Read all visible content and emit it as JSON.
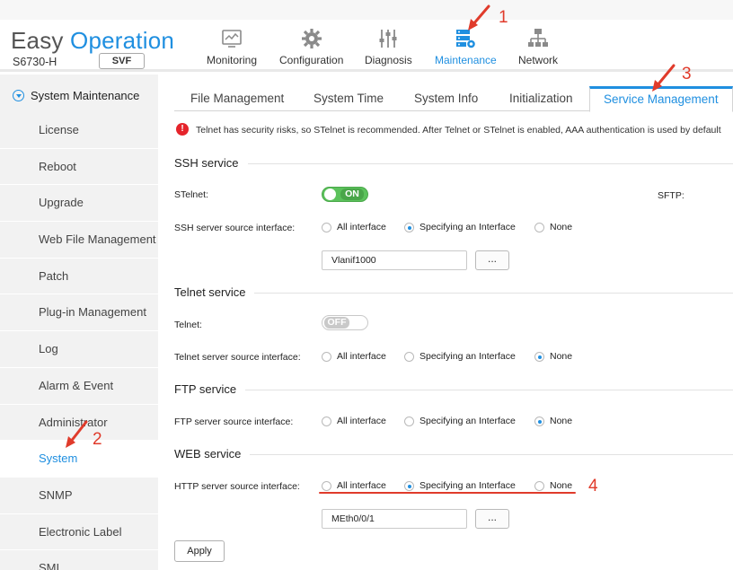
{
  "header": {
    "brand_part1": "Easy",
    "brand_part2": "Operation",
    "device_model": "S6730-H",
    "svf_label": "SVF",
    "nav": [
      {
        "label": "Monitoring",
        "icon": "monitor-icon"
      },
      {
        "label": "Configuration",
        "icon": "gear-icon"
      },
      {
        "label": "Diagnosis",
        "icon": "sliders-icon"
      },
      {
        "label": "Maintenance",
        "icon": "maintenance-icon",
        "active": true
      },
      {
        "label": "Network",
        "icon": "network-icon"
      }
    ],
    "accent_color": "#1f8fe0"
  },
  "sidebar": {
    "title": "System Maintenance",
    "items": [
      {
        "label": "License"
      },
      {
        "label": "Reboot"
      },
      {
        "label": "Upgrade"
      },
      {
        "label": "Web File Management"
      },
      {
        "label": "Patch"
      },
      {
        "label": "Plug-in Management"
      },
      {
        "label": "Log"
      },
      {
        "label": "Alarm & Event"
      },
      {
        "label": "Administrator"
      },
      {
        "label": "System",
        "active": true
      },
      {
        "label": "SNMP"
      },
      {
        "label": "Electronic Label"
      },
      {
        "label": "SMI"
      }
    ]
  },
  "tabs": [
    {
      "label": "File Management"
    },
    {
      "label": "System Time"
    },
    {
      "label": "System Info"
    },
    {
      "label": "Initialization"
    },
    {
      "label": "Service Management",
      "active": true
    }
  ],
  "warning": {
    "text": "Telnet has security risks, so STelnet is recommended. After Telnet or STelnet is enabled, AAA authentication is used by default"
  },
  "ssh": {
    "title": "SSH service",
    "stelnet_label": "STelnet:",
    "stelnet_state": "ON",
    "sftp_label": "SFTP:",
    "source_label": "SSH server source interface:",
    "options": [
      "All interface",
      "Specifying an Interface",
      "None"
    ],
    "selected": 1,
    "interface_value": "Vlanif1000",
    "browse_label": "..."
  },
  "telnet": {
    "title": "Telnet service",
    "telnet_label": "Telnet:",
    "telnet_state": "OFF",
    "source_label": "Telnet server source interface:",
    "options": [
      "All interface",
      "Specifying an Interface",
      "None"
    ],
    "selected": 2
  },
  "ftp": {
    "title": "FTP service",
    "source_label": "FTP server source interface:",
    "options": [
      "All interface",
      "Specifying an Interface",
      "None"
    ],
    "selected": 2
  },
  "web": {
    "title": "WEB service",
    "source_label": "HTTP server source interface:",
    "options": [
      "All interface",
      "Specifying an Interface",
      "None"
    ],
    "selected": 1,
    "interface_value": "MEth0/0/1",
    "browse_label": "..."
  },
  "apply_label": "Apply",
  "annotations": {
    "n1": "1",
    "n2": "2",
    "n3": "3",
    "n4": "4",
    "color": "#e03b2b"
  }
}
